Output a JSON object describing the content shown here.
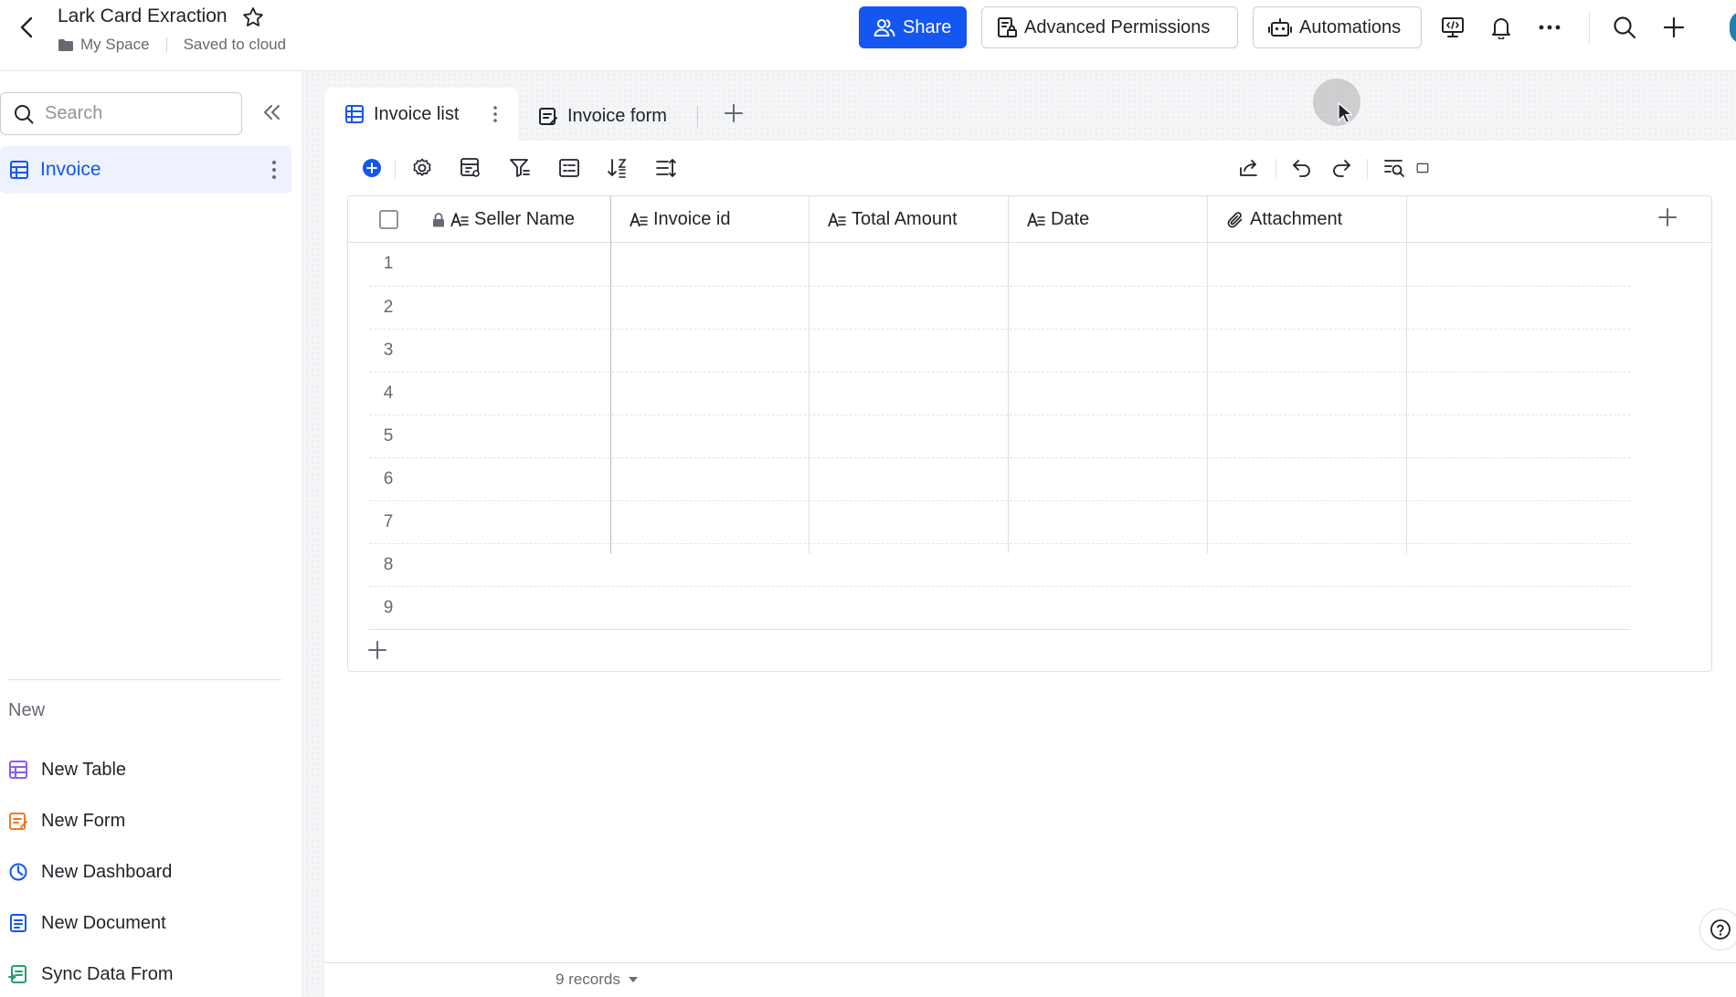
{
  "header": {
    "title": "Lark Card Exraction",
    "breadcrumb_folder": "My Space",
    "save_status": "Saved to cloud",
    "share_label": "Share",
    "permissions_label": "Advanced Permissions",
    "automations_label": "Automations",
    "accent_color": "#1456f0"
  },
  "sidebar": {
    "search_placeholder": "Search",
    "items": [
      {
        "label": "Invoice",
        "icon": "table-icon",
        "active": true
      }
    ],
    "new_section_label": "New",
    "new_items": [
      {
        "label": "New Table",
        "icon": "table-icon",
        "color": "#8b5cf6"
      },
      {
        "label": "New Form",
        "icon": "form-icon",
        "color": "#f07a22"
      },
      {
        "label": "New Dashboard",
        "icon": "dashboard-icon",
        "color": "#1456f0"
      },
      {
        "label": "New Document",
        "icon": "document-icon",
        "color": "#1456f0"
      },
      {
        "label": "Sync Data From",
        "icon": "sync-icon",
        "color": "#22a06b"
      }
    ]
  },
  "views": {
    "tabs": [
      {
        "label": "Invoice list",
        "icon": "grid-view-icon",
        "active": true
      },
      {
        "label": "Invoice form",
        "icon": "form-view-icon",
        "active": false
      }
    ]
  },
  "table": {
    "columns": [
      {
        "label": "Seller Name",
        "icon": "text-field-icon",
        "locked": true
      },
      {
        "label": "Invoice id",
        "icon": "text-field-icon"
      },
      {
        "label": "Total Amount",
        "icon": "text-field-icon"
      },
      {
        "label": "Date",
        "icon": "text-field-icon"
      },
      {
        "label": "Attachment",
        "icon": "attachment-icon"
      }
    ],
    "rows": [
      "1",
      "2",
      "3",
      "4",
      "5",
      "6",
      "7",
      "8",
      "9"
    ]
  },
  "footer": {
    "records_label": "9 records"
  }
}
